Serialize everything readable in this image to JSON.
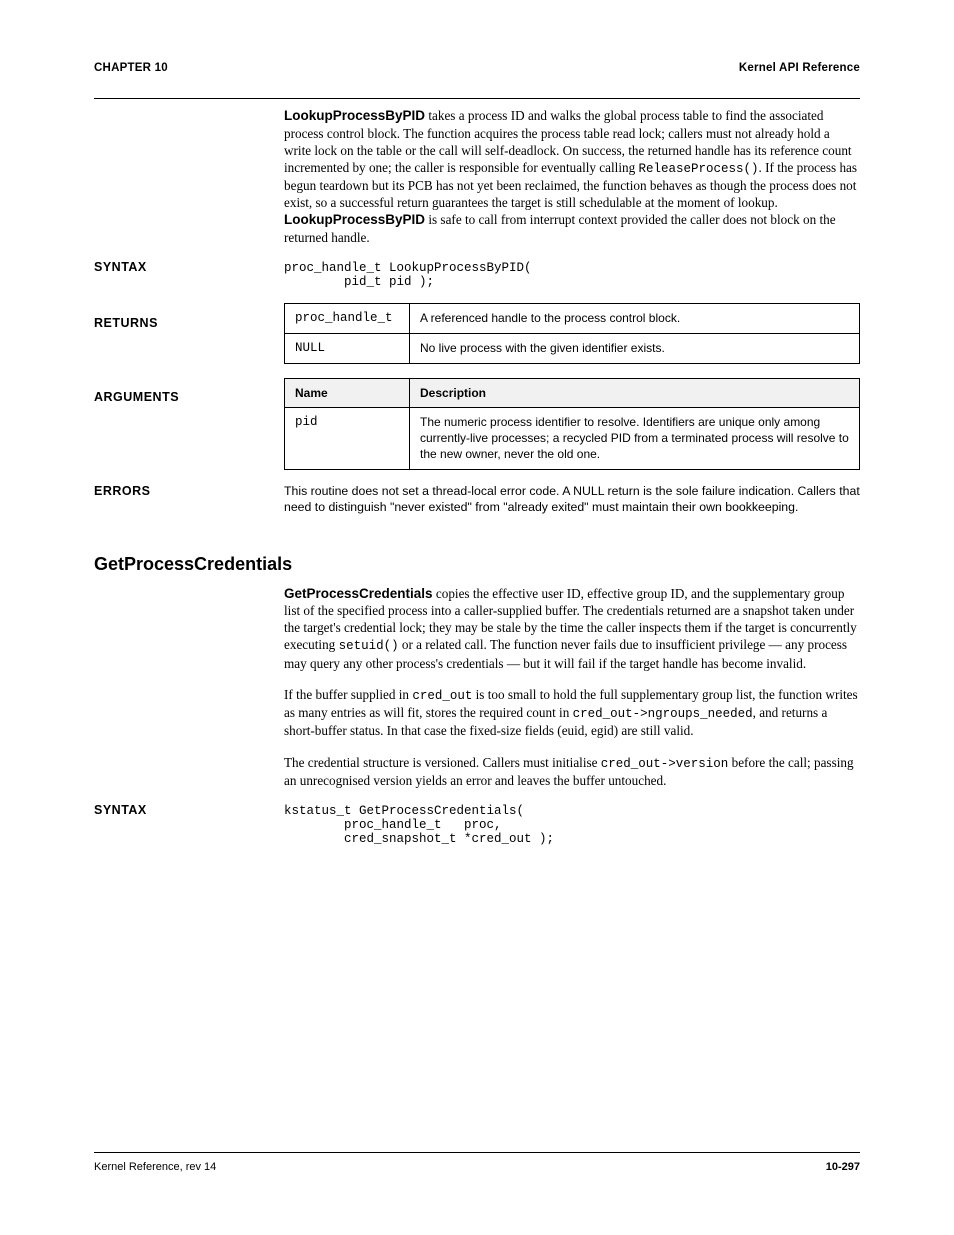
{
  "header": {
    "left": "CHAPTER 10",
    "right": "Kernel API Reference"
  },
  "intro": {
    "lead": "LookupProcessByPID",
    "tail": " takes a process ID and walks the global process table to find the associated process control block. The function acquires the process table read lock; callers must not already hold a write lock on the table or the call will self-deadlock. On success, the returned handle has its reference count incremented by one; the caller is responsible for eventually calling ",
    "code1": "ReleaseProcess()",
    "tail2": ". If the process has begun teardown but its PCB has not yet been reclaimed, the function behaves as though the process does not exist, so a successful return guarantees the target is still schedulable at the moment of lookup. ",
    "lead2": "LookupProcessByPID",
    "tail3": " is safe to call from interrupt context provided the caller does not block on the returned handle."
  },
  "syntax": {
    "label": "SYNTAX",
    "line1": "proc_handle_t LookupProcessByPID(",
    "line2_indent": "        pid_t pid );"
  },
  "returns": {
    "label": "RETURNS",
    "rows": [
      {
        "c0": "proc_handle_t",
        "c1": "A referenced handle to the process control block."
      },
      {
        "c0": "NULL",
        "c1": "No live process with the given identifier exists."
      }
    ]
  },
  "args": {
    "label": "ARGUMENTS",
    "head": {
      "c0": "Name",
      "c1": "Description"
    },
    "rows": [
      {
        "c0": "pid",
        "c1": "The numeric process identifier to resolve. Identifiers are unique only among currently-live processes; a recycled PID from a terminated process will resolve to the new owner, never the old one."
      }
    ]
  },
  "errors": {
    "label": "ERRORS",
    "text": "This routine does not set a thread-local error code. A NULL return is the sole failure indication. Callers that need to distinguish \"never existed\" from \"already exited\" must maintain their own bookkeeping."
  },
  "newsection": {
    "title": "GetProcessCredentials",
    "lead": "GetProcessCredentials",
    "para1_tail": " copies the effective user ID, effective group ID, and the supplementary group list of the specified process into a caller-supplied buffer. The credentials returned are a snapshot taken under the target's credential lock; they may be stale by the time the caller inspects them if the target is concurrently executing ",
    "code1": "setuid()",
    "para1_tail2": " or a related call. The function never fails due to insufficient privilege — any process may query any other process's credentials — but it will fail if the target handle has become invalid.",
    "para2_lead": "If the buffer supplied in ",
    "code2": "cred_out",
    "para2_mid": " is too small to hold the full supplementary group list, the function writes as many entries as will fit, stores the required count in ",
    "code3": "cred_out->ngroups_needed",
    "para2_tail": ", and returns a short-buffer status. In that case the fixed-size fields (euid, egid) are still valid.",
    "para3": "The credential structure is versioned. Callers must initialise ",
    "code4": "cred_out->version",
    "para3_tail": " before the call; passing an unrecognised version yields an error and leaves the buffer untouched."
  },
  "syntax2": {
    "label": "SYNTAX",
    "line1": "kstatus_t GetProcessCredentials(",
    "line2": "        proc_handle_t   proc,",
    "line3": "        cred_snapshot_t *cred_out );"
  },
  "footer": {
    "left": "Kernel Reference, rev 14",
    "right": "10-297"
  }
}
